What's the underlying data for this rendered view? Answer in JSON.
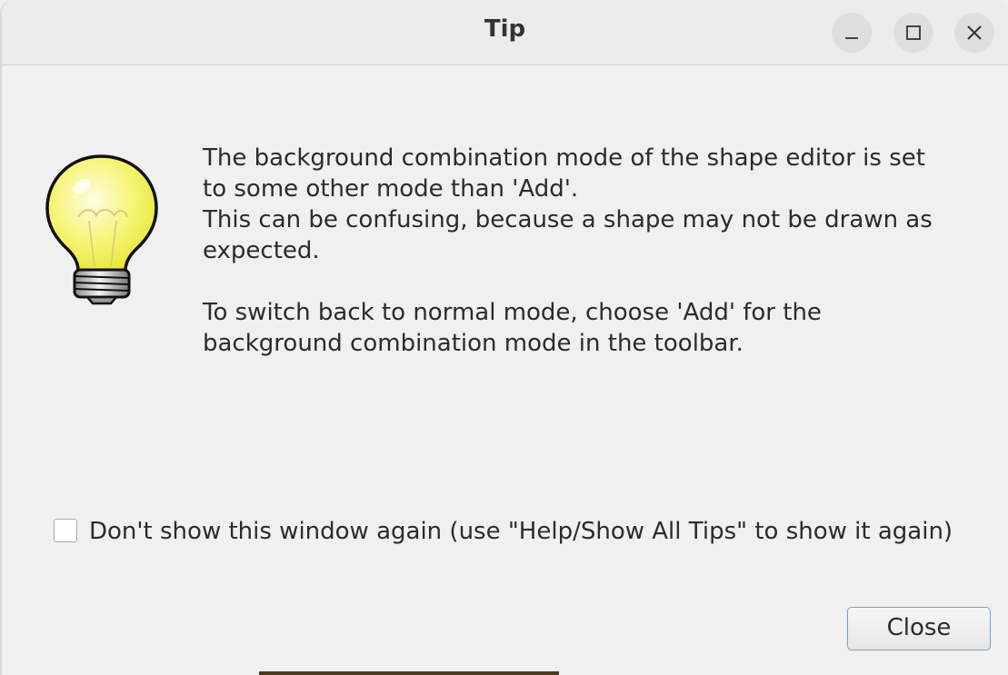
{
  "window": {
    "title": "Tip"
  },
  "titlebar_buttons": {
    "minimize": "minimize-icon",
    "maximize": "maximize-icon",
    "close": "close-icon"
  },
  "icon": "lightbulb-icon",
  "message": {
    "lines": [
      "The background combination mode of the shape editor is set",
      "to some other mode than 'Add'.",
      "This can be confusing, because a shape may not be drawn as",
      "expected.",
      "",
      "To switch back to normal mode, choose 'Add' for the",
      "background combination mode in the toolbar."
    ]
  },
  "dont_show_again": {
    "checked": false,
    "label": "Don't show this window again (use \"Help/Show All Tips\" to show it again)"
  },
  "buttons": {
    "close_label": "Close"
  }
}
